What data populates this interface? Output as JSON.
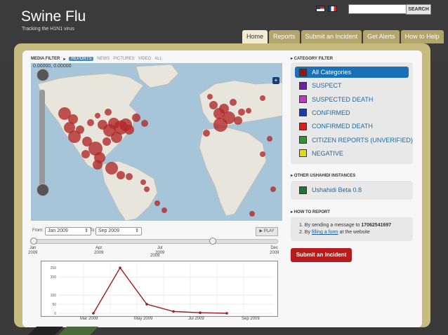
{
  "header": {
    "title": "Swine Flu",
    "tagline": "Tracking the H1N1 virus",
    "search_button": "SEARCH",
    "flags": [
      "flag-us-icon",
      "flag-fr-icon"
    ]
  },
  "nav": {
    "tabs": [
      {
        "label": "Home",
        "active": true
      },
      {
        "label": "Reports",
        "active": false
      },
      {
        "label": "Submit an Incident",
        "active": false
      },
      {
        "label": "Get Alerts",
        "active": false
      },
      {
        "label": "How to Help",
        "active": false
      }
    ]
  },
  "media_filter": {
    "label": "MEDIA FILTER",
    "items": [
      {
        "label": "REPORTS",
        "active": true
      },
      {
        "label": "NEWS",
        "active": false
      },
      {
        "label": "PICTURES",
        "active": false
      },
      {
        "label": "VIDEO",
        "active": false
      },
      {
        "label": "ALL",
        "active": false
      }
    ]
  },
  "map": {
    "coords": "0.00000, 0.00000",
    "layer_switch": "+"
  },
  "timeline": {
    "from_label": "From:",
    "from_value": "Jan 2009",
    "to_label": "To:",
    "to_value": "Sep 2009",
    "play": "PLAY",
    "ticks": [
      {
        "month": "Jan",
        "year": "2009"
      },
      {
        "month": "Apr",
        "year": "2009"
      },
      {
        "month": "Jul",
        "year": "2009"
      },
      {
        "month": "Dec",
        "year": "2009"
      }
    ],
    "mid_year": "2009"
  },
  "chart_data": {
    "type": "line",
    "x": [
      "Feb 2009",
      "Apr 2009",
      "May 2009",
      "Jun 2009",
      "Jul 2009",
      "Aug 2009"
    ],
    "values": [
      0,
      250,
      50,
      10,
      3,
      0
    ],
    "series": [
      {
        "values": [
          0,
          250,
          50,
          10,
          3,
          0
        ]
      }
    ],
    "ylim": [
      0,
      270
    ],
    "yticks": [
      "0",
      "50",
      "100",
      "200",
      "250"
    ],
    "xtick_labels": [
      "Mar 2009",
      "May 2009",
      "Jul 2009",
      "Sep 2009"
    ],
    "color": "#a01b1b",
    "grid": true
  },
  "category_filter": {
    "label": "CATEGORY FILTER",
    "items": [
      {
        "label": "All Categories",
        "color": "#8b1a1a",
        "active": true
      },
      {
        "label": "SUSPECT",
        "color": "#6a22a0",
        "active": false
      },
      {
        "label": "SUSPECTED DEATH",
        "color": "#c832c8",
        "active": false
      },
      {
        "label": "CONFIRMED",
        "color": "#1a3cb0",
        "active": false
      },
      {
        "label": "CONFIRMED DEATH",
        "color": "#e21a1a",
        "active": false
      },
      {
        "label": "CITIZEN REPORTS (UNVERIFIED)",
        "color": "#2a9a2a",
        "active": false
      },
      {
        "label": "NEGATIVE",
        "color": "#dcdc1a",
        "active": false
      }
    ]
  },
  "other_instances": {
    "label": "OTHER USHAHIDI INSTANCES",
    "item": "Ushahidi Beta 0.8",
    "item_color": "#1e7a2a"
  },
  "how_to_report": {
    "label": "HOW TO REPORT",
    "line1_prefix": "1.  By sending a message to ",
    "line1_number": "17062541697",
    "line2_prefix": "2.  By ",
    "line2_link": "filling a form",
    "line2_suffix": " at the website"
  },
  "submit_button": "Submit an Incident"
}
